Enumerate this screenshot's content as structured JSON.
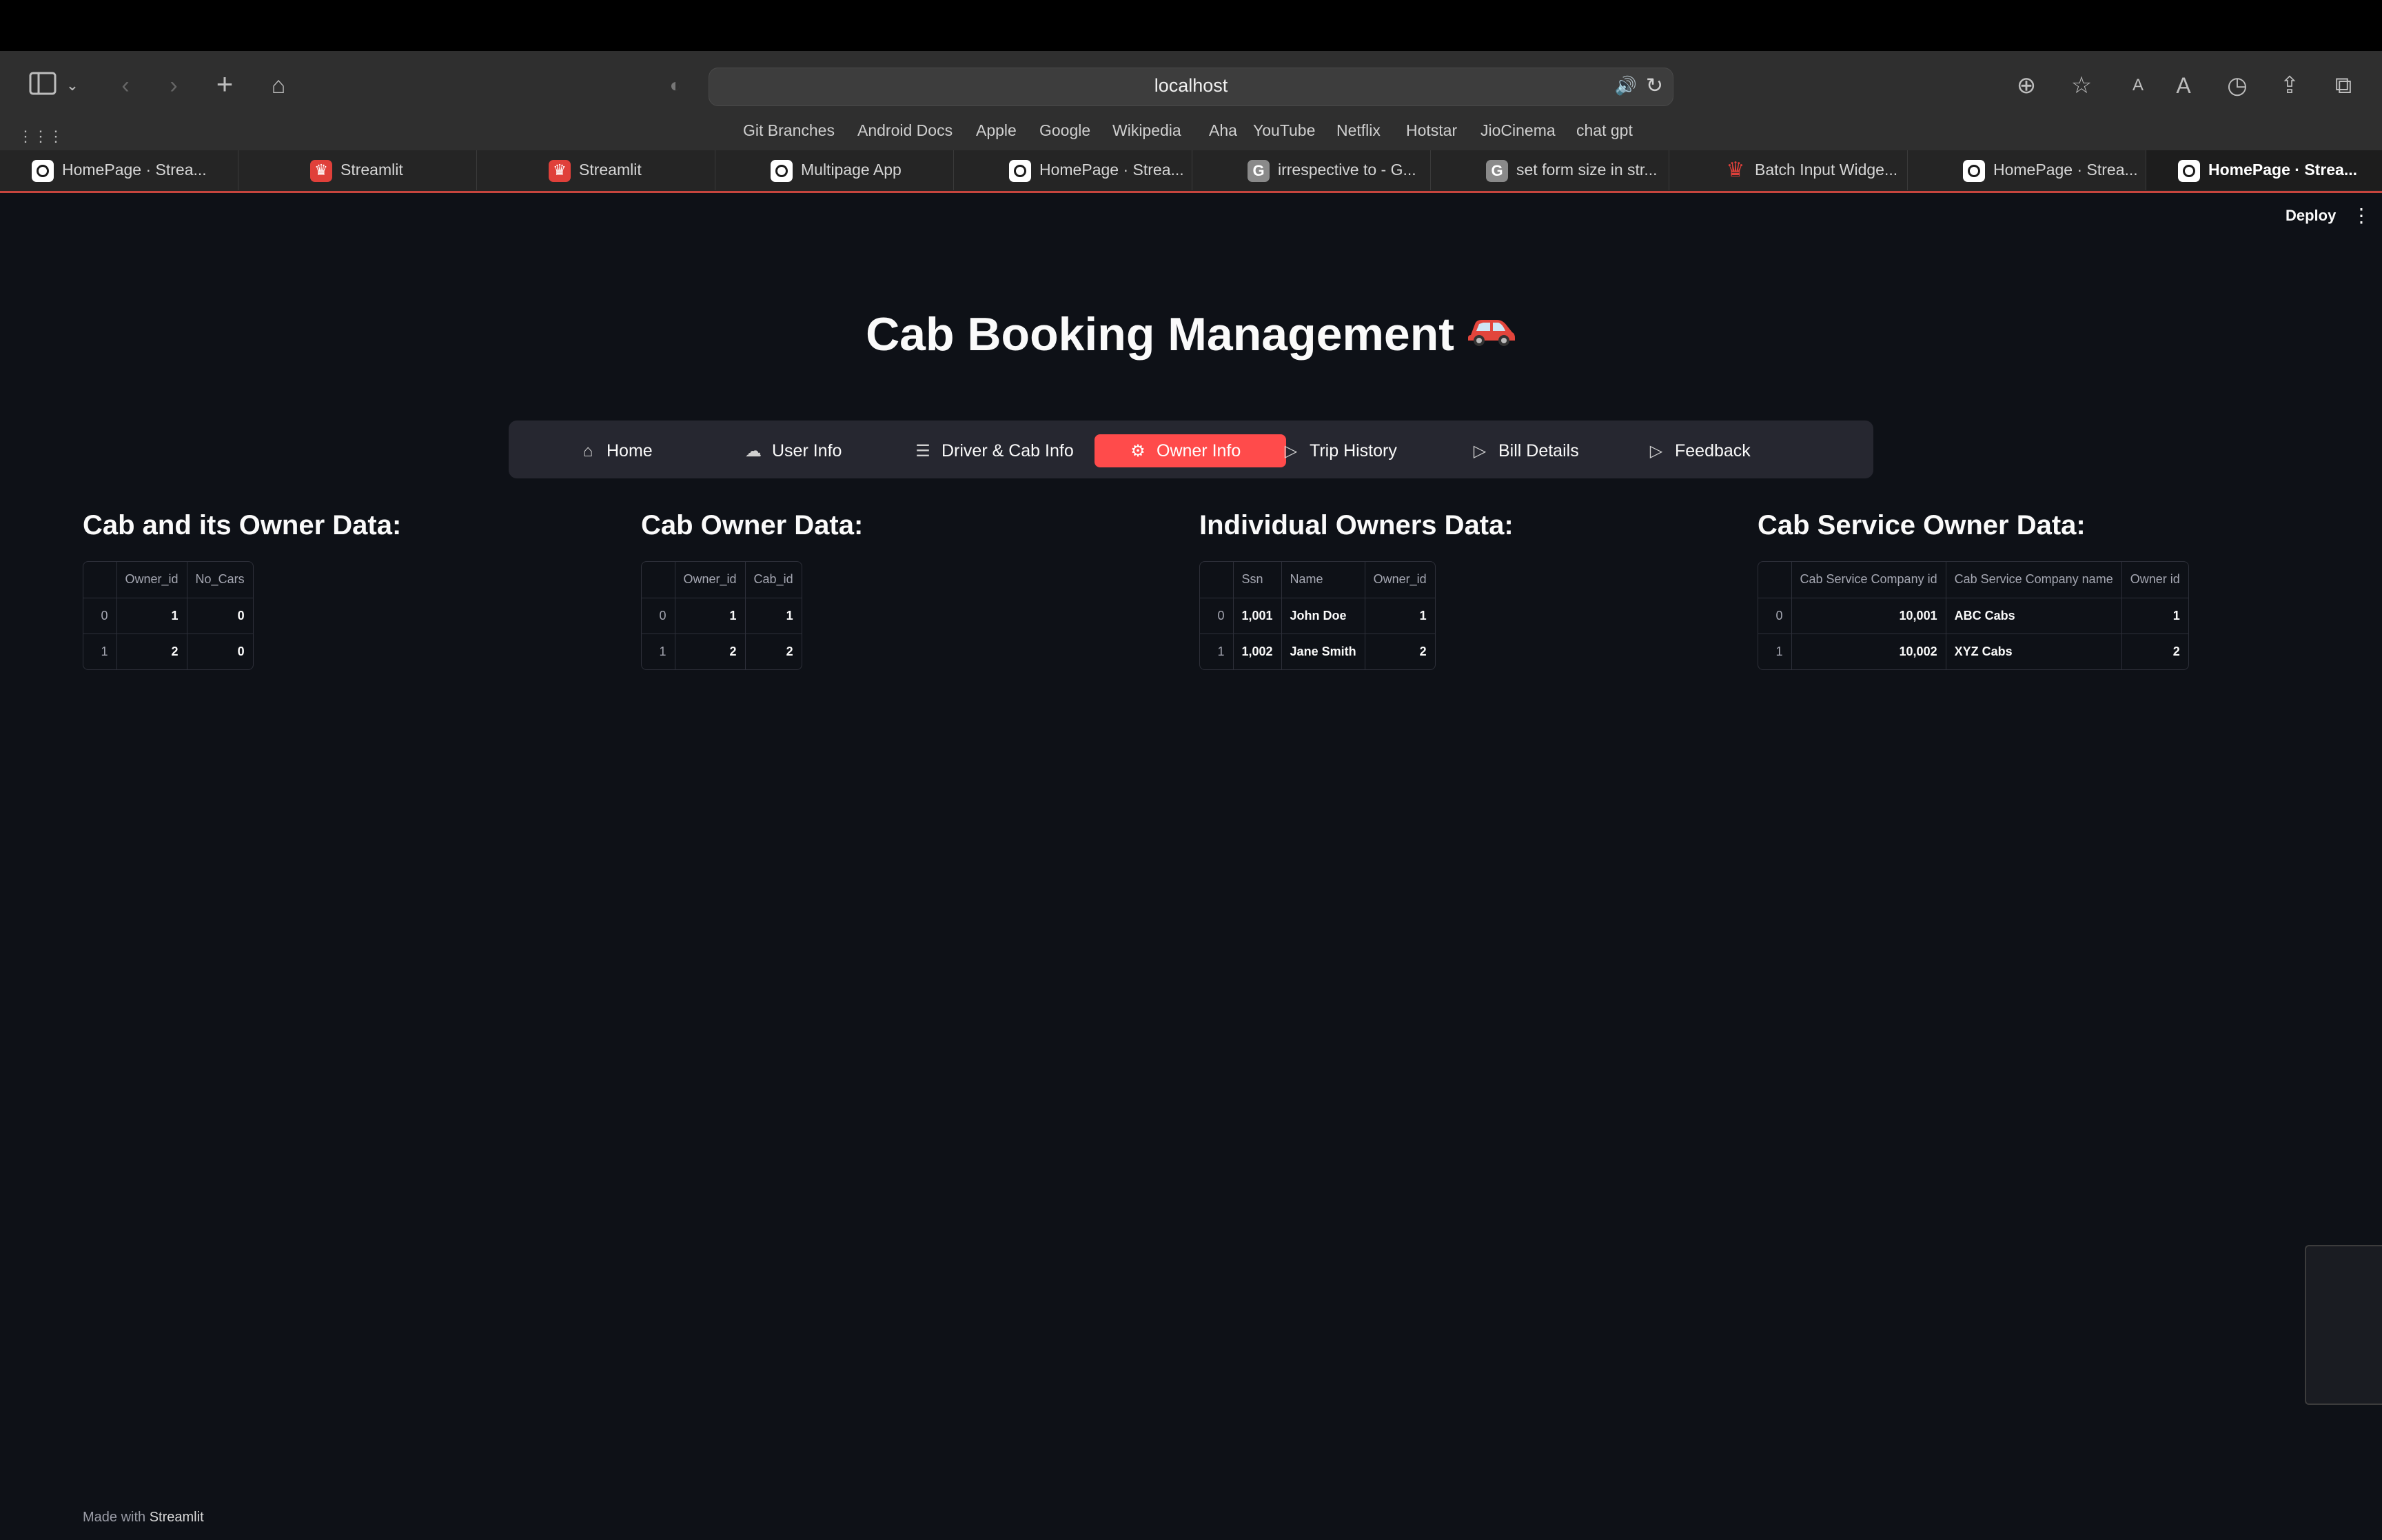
{
  "browser": {
    "url": "localhost",
    "favorites": [
      "Git Branches",
      "Android Docs",
      "Apple",
      "Google",
      "Wikipedia",
      "Aha",
      "YouTube",
      "Netflix",
      "Hotstar",
      "JioCinema",
      "chat gpt"
    ],
    "tabs": [
      {
        "label": "HomePage · Strea...",
        "icon": "streamlit-icon",
        "active": false
      },
      {
        "label": "Streamlit",
        "icon": "streamlit-red-icon",
        "active": false
      },
      {
        "label": "Streamlit",
        "icon": "streamlit-red-icon",
        "active": false
      },
      {
        "label": "Multipage App",
        "icon": "streamlit-icon",
        "active": false
      },
      {
        "label": "HomePage · Strea...",
        "icon": "streamlit-icon",
        "active": false
      },
      {
        "label": "irrespective to - G...",
        "icon": "g-icon",
        "active": false
      },
      {
        "label": "set form size in str...",
        "icon": "g-icon",
        "active": false
      },
      {
        "label": "Batch Input Widge...",
        "icon": "crown-icon",
        "active": false
      },
      {
        "label": "HomePage · Strea...",
        "icon": "streamlit-icon",
        "active": false
      },
      {
        "label": "HomePage · Strea...",
        "icon": "streamlit-icon",
        "active": true
      }
    ]
  },
  "app": {
    "deploy_label": "Deploy",
    "title": "Cab Booking Management",
    "nav": [
      {
        "label": "Home",
        "icon": "house-icon",
        "active": false
      },
      {
        "label": "User Info",
        "icon": "cloud-upload-icon",
        "active": false
      },
      {
        "label": "Driver & Cab Info",
        "icon": "list-icon",
        "active": false
      },
      {
        "label": "Owner Info",
        "icon": "gear-icon",
        "active": true
      },
      {
        "label": "Trip History",
        "icon": "play-icon",
        "active": false
      },
      {
        "label": "Bill Details",
        "icon": "play-icon",
        "active": false
      },
      {
        "label": "Feedback",
        "icon": "play-icon",
        "active": false
      }
    ],
    "sections": [
      {
        "heading": "Cab and its Owner Data:",
        "columns": [
          "",
          "Owner_id",
          "No_Cars"
        ],
        "rows": [
          [
            "0",
            "1",
            "0"
          ],
          [
            "1",
            "2",
            "0"
          ]
        ]
      },
      {
        "heading": "Cab Owner Data:",
        "columns": [
          "",
          "Owner_id",
          "Cab_id"
        ],
        "rows": [
          [
            "0",
            "1",
            "1"
          ],
          [
            "1",
            "2",
            "2"
          ]
        ]
      },
      {
        "heading": "Individual Owners Data:",
        "columns": [
          "",
          "Ssn",
          "Name",
          "Owner_id"
        ],
        "rows": [
          [
            "0",
            "1,001",
            "John Doe",
            "1"
          ],
          [
            "1",
            "1,002",
            "Jane Smith",
            "2"
          ]
        ]
      },
      {
        "heading": "Cab Service Owner Data:",
        "columns": [
          "",
          "Cab Service Company id",
          "Cab Service Company name",
          "Owner id"
        ],
        "rows": [
          [
            "0",
            "10,001",
            "ABC Cabs",
            "1"
          ],
          [
            "1",
            "10,002",
            "XYZ Cabs",
            "2"
          ]
        ]
      }
    ],
    "footer_prefix": "Made with",
    "footer_brand": "Streamlit"
  },
  "colors": {
    "background": "#0e1117",
    "accent": "#ff4b4b",
    "nav_bg": "#262730"
  }
}
